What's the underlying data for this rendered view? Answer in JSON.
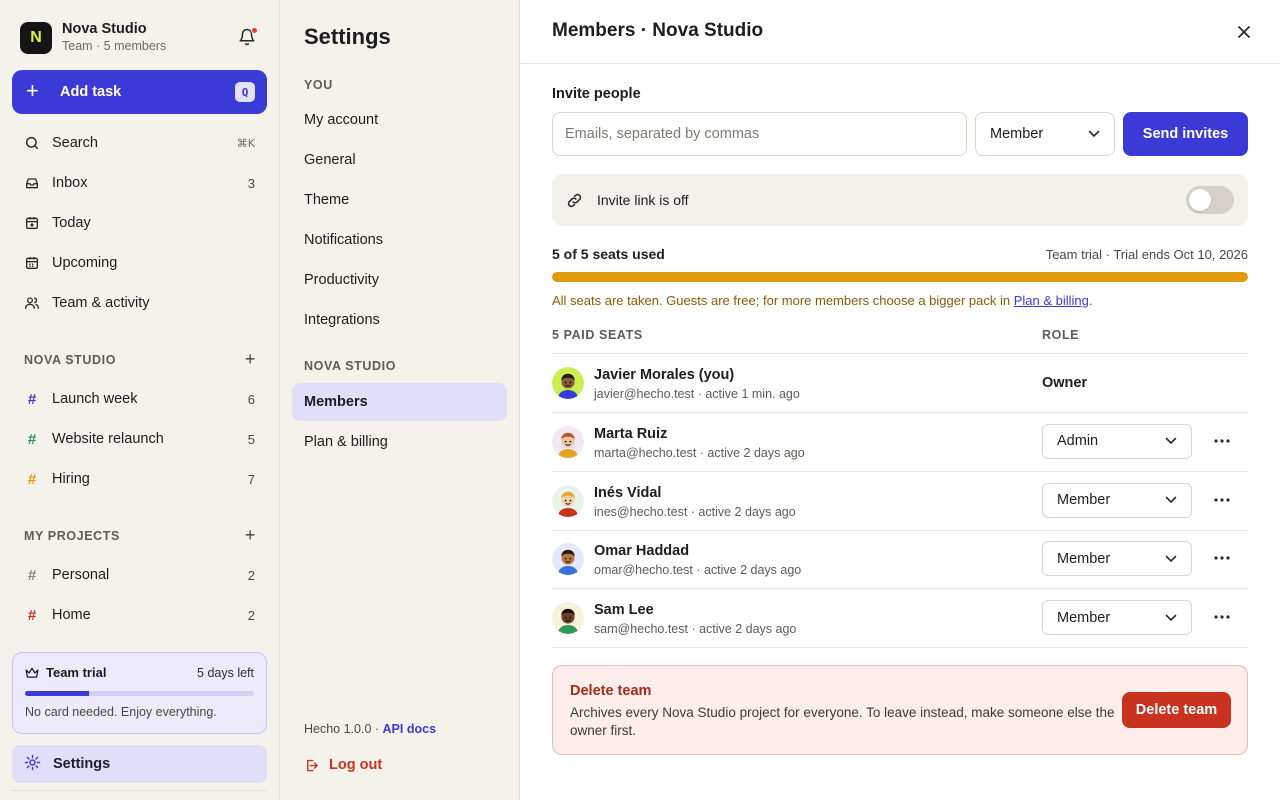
{
  "team": {
    "name": "Nova Studio",
    "subtitle": "Team · 5 members",
    "logo_letter": "N"
  },
  "sidebar": {
    "add_task": {
      "label": "Add task",
      "shortcut": "Q"
    },
    "nav": [
      {
        "label": "Search",
        "shortcut": "⌘K",
        "icon": "search-icon"
      },
      {
        "label": "Inbox",
        "count": "3",
        "icon": "inbox-icon"
      },
      {
        "label": "Today",
        "icon": "calendar-today-icon"
      },
      {
        "label": "Upcoming",
        "icon": "calendar-upcoming-icon"
      },
      {
        "label": "Team & activity",
        "icon": "team-icon"
      }
    ],
    "team_section": {
      "title": "NOVA STUDIO",
      "projects": [
        {
          "label": "Launch week",
          "count": "6",
          "color": "#3c3ad6"
        },
        {
          "label": "Website relaunch",
          "count": "5",
          "color": "#1f9a4f"
        },
        {
          "label": "Hiring",
          "count": "7",
          "color": "#e09b0d"
        }
      ]
    },
    "my_section": {
      "title": "MY PROJECTS",
      "projects": [
        {
          "label": "Personal",
          "count": "2",
          "color": "#8a8680"
        },
        {
          "label": "Home",
          "count": "2",
          "color": "#c8321f"
        }
      ]
    },
    "trial": {
      "title": "Team trial",
      "days_left": "5 days left",
      "note": "No card needed. Enjoy everything.",
      "progress": 0.28
    },
    "settings_label": "Settings"
  },
  "settings_nav": {
    "title": "Settings",
    "you_header": "YOU",
    "you_items": [
      "My account",
      "General",
      "Theme",
      "Notifications",
      "Productivity",
      "Integrations"
    ],
    "team_header": "NOVA STUDIO",
    "team_items": [
      "Members",
      "Plan & billing"
    ],
    "active_item": "Members",
    "version": "Hecho 1.0.0 ·",
    "api_docs": "API docs",
    "logout": "Log out"
  },
  "panel": {
    "title": "Members · Nova Studio",
    "invite": {
      "label": "Invite people",
      "placeholder": "Emails, separated by commas",
      "value": "",
      "role": "Member",
      "send": "Send invites"
    },
    "invite_link": {
      "label": "Invite link is off",
      "enabled": false
    },
    "seats": {
      "used_label": "5 of 5 seats used",
      "trial_info": "Team trial · Trial ends Oct 10, 2026",
      "used": 5,
      "total": 5,
      "note_prefix": "All seats are taken. Guests are free; for more members choose a bigger pack in",
      "note_link": "Plan & billing",
      "note_suffix": ".",
      "bar_color": "#e09b0d"
    },
    "table": {
      "seats_header": "5 PAID SEATS",
      "role_header": "ROLE"
    },
    "members": [
      {
        "name": "Javier Morales (you)",
        "sub": "javier@hecho.test · active 1 min. ago",
        "role": "Owner",
        "editable": false,
        "avatar_bg": "#c7ef52",
        "skin": "#8a5a3b",
        "hair": "#2a1a10",
        "shirt": "#3c3ad6"
      },
      {
        "name": "Marta Ruiz",
        "sub": "marta@hecho.test · active 2 days ago",
        "role": "Admin",
        "editable": true,
        "avatar_bg": "#f0e7f7",
        "skin": "#f1c6a1",
        "hair": "#b35b2a",
        "shirt": "#e0a51c"
      },
      {
        "name": "Inés Vidal",
        "sub": "ines@hecho.test · active 2 days ago",
        "role": "Member",
        "editable": true,
        "avatar_bg": "#e6f4ea",
        "skin": "#f6d2b0",
        "hair": "#e8a530",
        "shirt": "#c8321f"
      },
      {
        "name": "Omar Haddad",
        "sub": "omar@hecho.test · active 2 days ago",
        "role": "Member",
        "editable": true,
        "avatar_bg": "#e6e8fb",
        "skin": "#b5764a",
        "hair": "#2a1a10",
        "shirt": "#3c6fd6"
      },
      {
        "name": "Sam Lee",
        "sub": "sam@hecho.test · active 2 days ago",
        "role": "Member",
        "editable": true,
        "avatar_bg": "#f7f1dc",
        "skin": "#6b3f22",
        "hair": "#1b120c",
        "shirt": "#2f9a57"
      }
    ],
    "danger": {
      "title": "Delete team",
      "text": "Archives every Nova Studio project for everyone. To leave instead, make someone else the owner first.",
      "button": "Delete team"
    }
  },
  "colors": {
    "accent": "#3c3ad6",
    "danger": "#c8321f",
    "warning": "#e09b0d"
  }
}
